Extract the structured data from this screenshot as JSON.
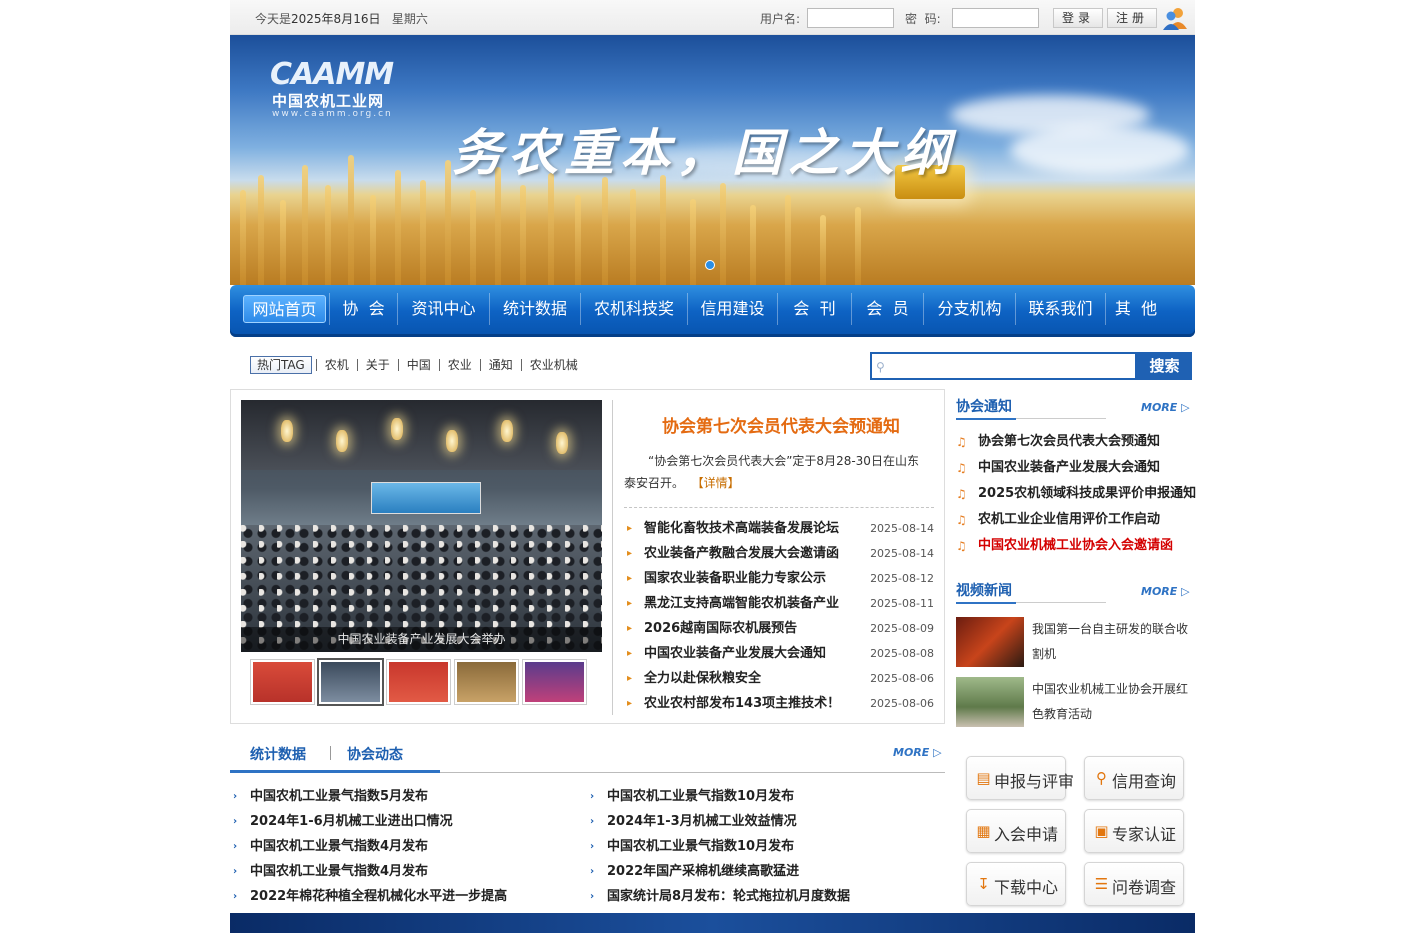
{
  "topbar": {
    "date_prefix": "今天是",
    "date_value": "2025年8月16日",
    "weekday": "星期六",
    "username_label": "用户名:",
    "password_label": "密  码:",
    "login_label": "登录",
    "register_label": "注册"
  },
  "banner": {
    "logo_en": "CAAMM",
    "logo_cn": "中国农机工业网",
    "logo_url": "www.caamm.org.cn",
    "slogan": "务农重本，国之大纲"
  },
  "nav": [
    "网站首页",
    "协  会",
    "资讯中心",
    "统计数据",
    "农机科技奖",
    "信用建设",
    "会  刊",
    "会  员",
    "分支机构",
    "联系我们",
    "其  他"
  ],
  "tags": {
    "label": "热门TAG",
    "items": [
      "农机",
      "关于",
      "中国",
      "农业",
      "通知",
      "农业机械"
    ]
  },
  "search": {
    "button": "搜索"
  },
  "feature": {
    "photo_caption": "中国农业装备产业发展大会举办",
    "headline": "协会第七次会员代表大会预通知",
    "summary": "“协会第七次会员代表大会”定于8月28-30日在山东泰安召开。",
    "summary_more": "【详情】",
    "news": [
      {
        "title": "智能化畜牧技术高端装备发展论坛",
        "date": "2025-08-14"
      },
      {
        "title": "农业装备产教融合发展大会邀请函",
        "date": "2025-08-14"
      },
      {
        "title": "国家农业装备职业能力专家公示",
        "date": "2025-08-12"
      },
      {
        "title": "黑龙江支持高端智能农机装备产业",
        "date": "2025-08-11"
      },
      {
        "title": "2026越南国际农机展预告",
        "date": "2025-08-09"
      },
      {
        "title": "中国农业装备产业发展大会通知",
        "date": "2025-08-08"
      },
      {
        "title": "全力以赴保秋粮安全",
        "date": "2025-08-06"
      },
      {
        "title": "农业农村部发布143项主推技术！",
        "date": "2025-08-06"
      }
    ]
  },
  "notices": {
    "title": "协会通知",
    "more": "MORE",
    "items": [
      "协会第七次会员代表大会预通知",
      "中国农业装备产业发展大会通知",
      "2025农机领域科技成果评价申报通知",
      "农机工业企业信用评价工作启动",
      "中国农业机械工业协会入会邀请函"
    ]
  },
  "videos": {
    "title": "视频新闻",
    "more": "MORE",
    "items": [
      "我国第一台自主研发的联合收割机",
      "中国农业机械工业协会开展红色教育活动"
    ]
  },
  "tabs": {
    "items": [
      "统计数据",
      "协会动态"
    ],
    "more": "MORE"
  },
  "stats": {
    "left": [
      "中国农机工业景气指数5月发布",
      "2024年1-6月机械工业进出口情况",
      "中国农机工业景气指数4月发布",
      "中国农机工业景气指数4月发布",
      "2022年棉花种植全程机械化水平进一步提高"
    ],
    "right": [
      "中国农机工业景气指数10月发布",
      "2024年1-3月机械工业效益情况",
      "中国农机工业景气指数10月发布",
      "2022年国产采棉机继续高歌猛进",
      "国家统计局8月发布：轮式拖拉机月度数据"
    ]
  },
  "services": [
    "申报与评审",
    "信用查询",
    "入会申请",
    "专家认证",
    "下载中心",
    "问卷调查"
  ],
  "colors": {
    "nav_blue": "#0e63c4",
    "link_blue": "#1d5fb0",
    "headline_orange": "#e46b12",
    "alert_red": "#d40000"
  }
}
